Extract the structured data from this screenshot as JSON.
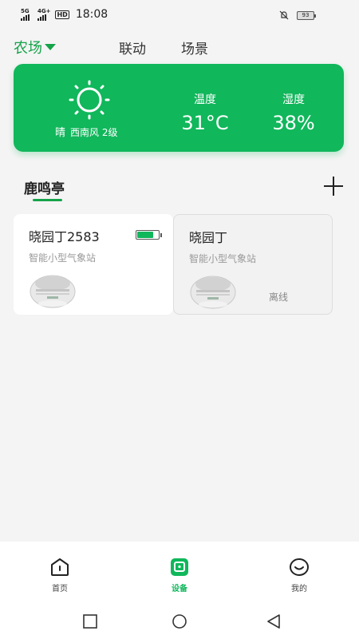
{
  "status_bar": {
    "network_1": "5G",
    "network_2": "4G+",
    "hd": "HD",
    "time": "18:08",
    "battery": "93"
  },
  "top_nav": {
    "farm": "农场",
    "tabs": [
      "联动",
      "场景"
    ]
  },
  "weather": {
    "condition": "晴",
    "wind": "西南风 2级",
    "temperature_label": "温度",
    "temperature_value": "31°C",
    "humidity_label": "湿度",
    "humidity_value": "38%",
    "card_color": "#10b75b"
  },
  "group": {
    "title": "鹿鸣亭",
    "add_icon": "plus-icon"
  },
  "devices": [
    {
      "name": "晓园丁2583",
      "type": "智能小型气象站",
      "status": "online",
      "battery_level": 0.75
    },
    {
      "name": "晓园丁",
      "type": "智能小型气象站",
      "status": "offline",
      "status_label": "离线"
    }
  ],
  "tab_bar": {
    "items": [
      {
        "label": "首页",
        "icon": "home-icon"
      },
      {
        "label": "设备",
        "icon": "device-icon",
        "active": true
      },
      {
        "label": "我的",
        "icon": "profile-icon"
      }
    ]
  },
  "colors": {
    "accent": "#16a34a",
    "card_green": "#10b75b"
  }
}
